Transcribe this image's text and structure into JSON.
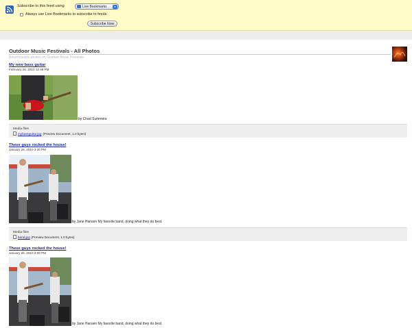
{
  "subscribe": {
    "label": "Subscribe to this feed using",
    "reader_selected": "Live Bookmarks",
    "always_label": "Always use Live Bookmarks to subscribe to feeds.",
    "button_label": "Subscribe Now"
  },
  "feed": {
    "title": "Outdoor Music Festivals - All Photos",
    "subtitle": "Recent public photos on Outdoor Music Festivals"
  },
  "entries": [
    {
      "title": "My new bass guitar",
      "date": "February 26, 2010 12:49 PM",
      "byline": "by Chad Summers",
      "media_heading": "Media files",
      "media_file": "mybassguitar.jpg",
      "media_info": "(Preview Document, 1.0 bytes)"
    },
    {
      "title": "These guys rocked the house!",
      "date": "January 26, 2010 3:20 PM",
      "byline": "by Jane Hansen My favorite band, doing what they do best.",
      "media_heading": "Media files",
      "media_file": "band.jpg",
      "media_info": "(Preview Document, 1.0 bytes)"
    },
    {
      "title": "These guys rocked the house!",
      "date": "January 26, 2010 3:09 PM",
      "byline": "by Jane Hansen My favorite band, doing what they do best."
    }
  ],
  "colors": {
    "header_bg": "#fffbc9",
    "link": "#1a25a8",
    "media_box_bg": "#eeeeee"
  }
}
